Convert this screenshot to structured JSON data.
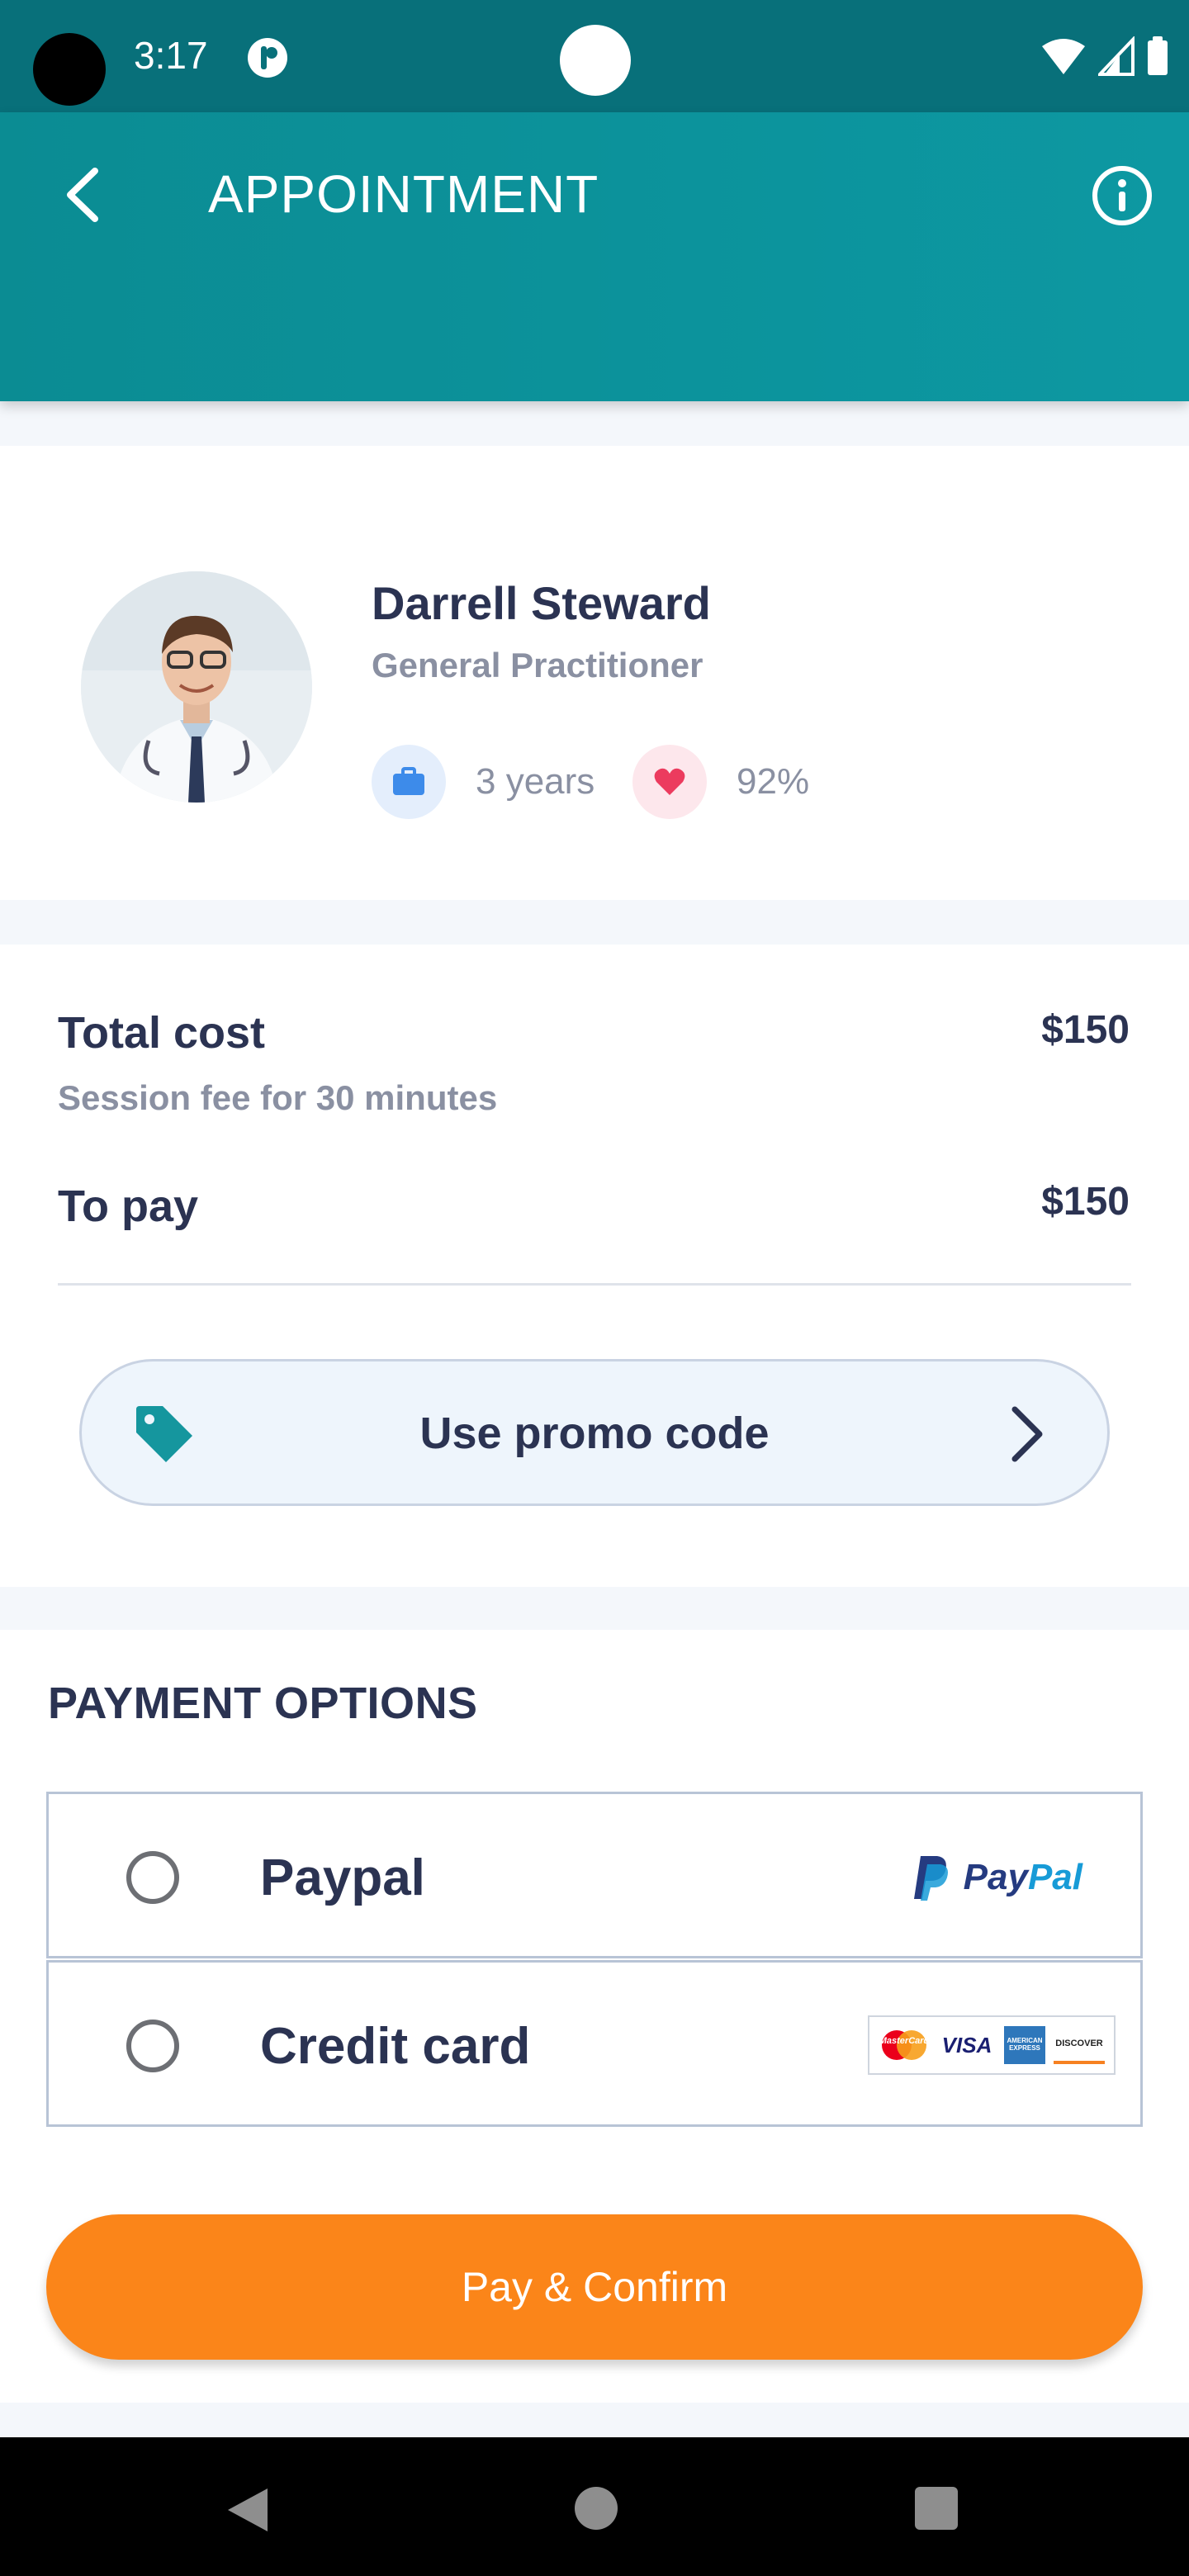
{
  "status_bar": {
    "time": "3:17"
  },
  "app_bar": {
    "title": "APPOINTMENT"
  },
  "doctor": {
    "name": "Darrell Steward",
    "role": "General Practitioner",
    "experience": "3 years",
    "rating": "92%"
  },
  "cost": {
    "total_label": "Total cost",
    "total_sub": "Session fee for 30 minutes",
    "total_value": "$150",
    "to_pay_label": "To pay",
    "to_pay_value": "$150",
    "promo_label": "Use promo code"
  },
  "payment": {
    "title": "PAYMENT OPTIONS",
    "options": [
      {
        "label": "Paypal",
        "logo": "paypal-logo",
        "selected": false
      },
      {
        "label": "Credit card",
        "logo": "card-brands-logo",
        "selected": false
      }
    ],
    "paypal_logo_text": {
      "pay": "Pay",
      "pal": "Pal"
    },
    "card_brands": [
      "MasterCard",
      "VISA",
      "AMERICAN EXPRESS",
      "DISCOVER"
    ],
    "confirm_label": "Pay & Confirm"
  },
  "colors": {
    "primary": "#0b8c93",
    "accent": "#fb8519",
    "text": "#2b3352",
    "muted": "#8a90a2"
  }
}
